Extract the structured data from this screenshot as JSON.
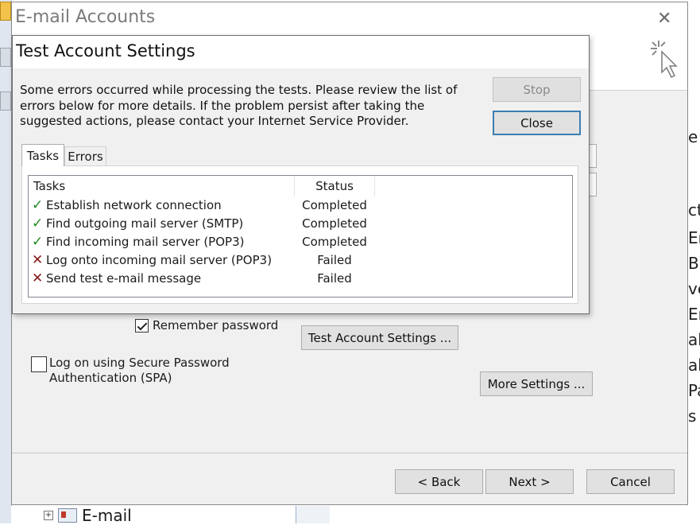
{
  "background": {
    "tree_item_label": "E-mail",
    "right_fragments": [
      "e",
      "ct",
      "Er",
      "Ba",
      "ve",
      "Er",
      "ab",
      "ab",
      "Pa",
      "s J"
    ]
  },
  "accounts_dialog": {
    "title": "E-mail Accounts",
    "close_glyph": "✕",
    "remember_password_label": "Remember password",
    "remember_password_checked": true,
    "spa_label_line1": "Log on using Secure Password",
    "spa_label_line2": "Authentication (SPA)",
    "spa_checked": false,
    "test_account_settings_button": "Test Account Settings ...",
    "more_settings_button": "More Settings ...",
    "back_button": "< Back",
    "next_button": "Next >",
    "cancel_button": "Cancel"
  },
  "test_dialog": {
    "title": "Test Account Settings",
    "message": "Some errors occurred while processing the tests. Please review the list of errors below for more details. If the problem persist after taking the suggested actions, please contact your Internet Service Provider.",
    "stop_button": "Stop",
    "stop_enabled": false,
    "close_button": "Close",
    "tabs": [
      {
        "label": "Tasks",
        "active": true
      },
      {
        "label": "Errors",
        "active": false
      }
    ],
    "columns": {
      "tasks": "Tasks",
      "status": "Status"
    },
    "rows": [
      {
        "task": "Establish network connection",
        "status": "Completed",
        "icon": "check-icon",
        "icon_glyph": "✓"
      },
      {
        "task": "Find outgoing mail server (SMTP)",
        "status": "Completed",
        "icon": "check-icon",
        "icon_glyph": "✓"
      },
      {
        "task": "Find incoming mail server (POP3)",
        "status": "Completed",
        "icon": "check-icon",
        "icon_glyph": "✓"
      },
      {
        "task": "Log onto incoming mail server (POP3)",
        "status": "Failed",
        "icon": "x-icon",
        "icon_glyph": "✕"
      },
      {
        "task": "Send test e-mail message",
        "status": "Failed",
        "icon": "x-icon",
        "icon_glyph": "✕"
      }
    ]
  },
  "colors": {
    "success": "#1f8a1f",
    "failure": "#8b1a1a",
    "default_button_border": "#3c7fb1"
  }
}
